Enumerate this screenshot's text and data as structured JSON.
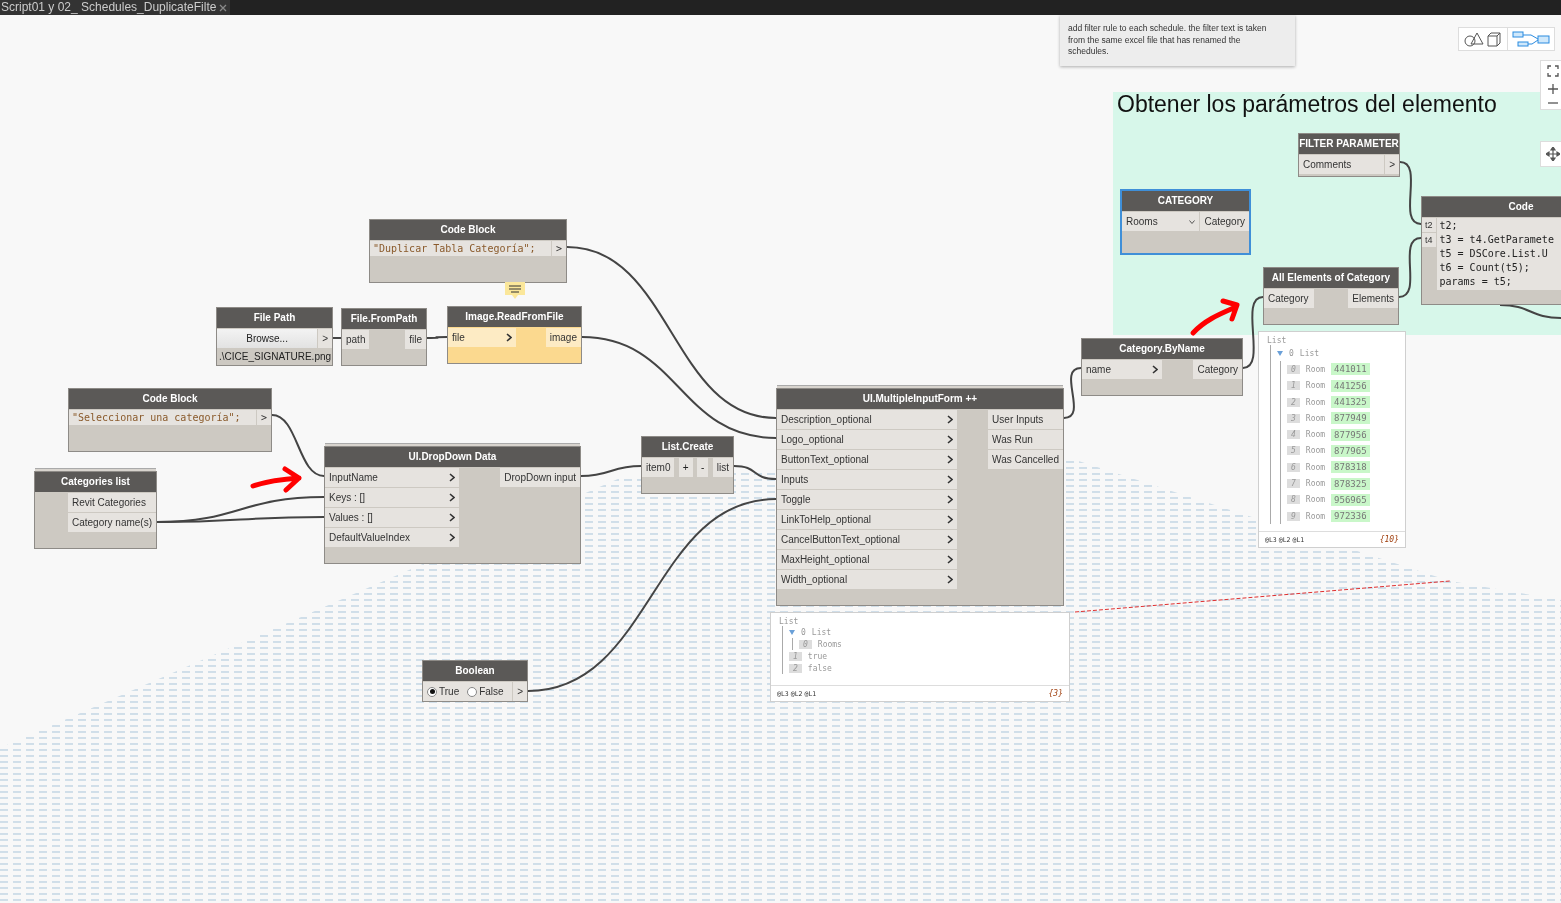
{
  "tab": {
    "title": "Script01 y 02_ Schedules_DuplicateFilte"
  },
  "note": {
    "text": "add filter rule to each schedule. the filter text is taken from the same excel file that has renamed the schedules."
  },
  "group": {
    "title": "Obtener los parámetros del elemento"
  },
  "nodes": [
    {
      "kind": "code",
      "title": "Code Block",
      "lines": [
        "\"Duplicar Tabla Categoría\";"
      ],
      "outputs": [
        ">"
      ],
      "selected": false,
      "warning": false,
      "custom": false
    },
    {
      "kind": "path",
      "title": "File Path",
      "button": "Browse...",
      "outputs": [
        ">"
      ],
      "value": ".\\CICE_SIGNATURE.png",
      "selected": false,
      "warning": false,
      "custom": false
    },
    {
      "kind": "function",
      "title": "File.FromPath",
      "inputs": [
        "path"
      ],
      "outputs": [
        "file"
      ],
      "arrows": false,
      "selected": false,
      "warning": false,
      "custom": false
    },
    {
      "kind": "function",
      "title": "Image.ReadFromFile",
      "inputs": [
        "file"
      ],
      "outputs": [
        "image"
      ],
      "arrows": true,
      "selected": false,
      "warning": true,
      "custom": false
    },
    {
      "kind": "code",
      "title": "Code Block",
      "lines": [
        "\"Seleccionar una categoría\";"
      ],
      "outputs": [
        ">"
      ],
      "selected": false,
      "warning": false,
      "custom": false
    },
    {
      "kind": "function",
      "title": "Categories list",
      "outputs": [
        "Revit Categories",
        "Category name(s)"
      ],
      "selected": false,
      "warning": false,
      "custom": true
    },
    {
      "kind": "function",
      "title": "UI.DropDown Data",
      "inputs": [
        "InputName",
        "Keys : []",
        "Values : []",
        "DefaultValueIndex"
      ],
      "outputs": [
        "DropDown input"
      ],
      "arrows": true,
      "selected": false,
      "warning": false,
      "custom": true
    },
    {
      "kind": "listcreate",
      "title": "List.Create",
      "inputs": [
        "item0"
      ],
      "buttons": [
        "+",
        "-"
      ],
      "outputs": [
        "list"
      ],
      "selected": false,
      "warning": false,
      "custom": false
    },
    {
      "kind": "boolean",
      "title": "Boolean",
      "options": [
        {
          "label": "True",
          "selected": true
        },
        {
          "label": "False",
          "selected": false
        }
      ],
      "outputs": [
        ">"
      ],
      "selected": false,
      "warning": false,
      "custom": false
    },
    {
      "kind": "function",
      "title": "UI.MultipleInputForm ++",
      "inputs": [
        "Description_optional",
        "Logo_optional",
        "ButtonText_optional",
        "Inputs",
        "Toggle",
        "LinkToHelp_optional",
        "CancelButtonText_optional",
        "MaxHeight_optional",
        "Width_optional"
      ],
      "outputs": [
        "User Inputs",
        "Was Run",
        "Was Cancelled"
      ],
      "arrows": true,
      "selected": false,
      "warning": false,
      "custom": true,
      "preview": {
        "title": "List",
        "items": [
          {
            "index": "0",
            "label": "List",
            "expanded": true,
            "children": [
              {
                "index": "0",
                "label": "Rooms"
              }
            ]
          },
          {
            "index": "1",
            "label": "true"
          },
          {
            "index": "2",
            "label": "false"
          }
        ],
        "levels": [
          "@L3",
          "@L2",
          "@L1"
        ],
        "count": "{3}"
      }
    },
    {
      "kind": "dropdown",
      "title": "CATEGORY",
      "value": "Rooms",
      "outputs": [
        "Category"
      ],
      "selected": true,
      "warning": false,
      "custom": false
    },
    {
      "kind": "function",
      "title": "Category.ByName",
      "inputs": [
        "name"
      ],
      "outputs": [
        "Category"
      ],
      "arrows": true,
      "selected": false,
      "warning": false,
      "custom": false
    },
    {
      "kind": "string",
      "title": "FILTER PARAMETER",
      "value": "Comments",
      "outputs": [
        ">"
      ],
      "selected": false,
      "warning": false,
      "custom": false
    },
    {
      "kind": "function",
      "title": "All Elements of Category",
      "inputs": [
        "Category"
      ],
      "outputs": [
        "Elements"
      ],
      "arrows": false,
      "selected": false,
      "warning": false,
      "custom": false,
      "preview": {
        "title": "List",
        "items": [
          {
            "index": "0",
            "label": "List",
            "expanded": true,
            "children": [
              {
                "index": "0",
                "label": "Room",
                "id": "441011"
              },
              {
                "index": "1",
                "label": "Room",
                "id": "441256"
              },
              {
                "index": "2",
                "label": "Room",
                "id": "441325"
              },
              {
                "index": "3",
                "label": "Room",
                "id": "877949"
              },
              {
                "index": "4",
                "label": "Room",
                "id": "877956"
              },
              {
                "index": "5",
                "label": "Room",
                "id": "877965"
              },
              {
                "index": "6",
                "label": "Room",
                "id": "878318"
              },
              {
                "index": "7",
                "label": "Room",
                "id": "878325"
              },
              {
                "index": "8",
                "label": "Room",
                "id": "956965"
              },
              {
                "index": "9",
                "label": "Room",
                "id": "972336"
              }
            ]
          }
        ],
        "levels": [
          "@L3",
          "@L2",
          "@L1"
        ],
        "count": "{10}"
      }
    },
    {
      "kind": "code",
      "title": "Code",
      "inputs": [
        "t2",
        "t4"
      ],
      "lines": [
        "t2;",
        "t3 = t4.GetParamete",
        "t5 = DSCore.List.U",
        "t6 = Count(t5);",
        "params = t5;"
      ],
      "selected": false,
      "warning": false,
      "custom": false
    }
  ]
}
